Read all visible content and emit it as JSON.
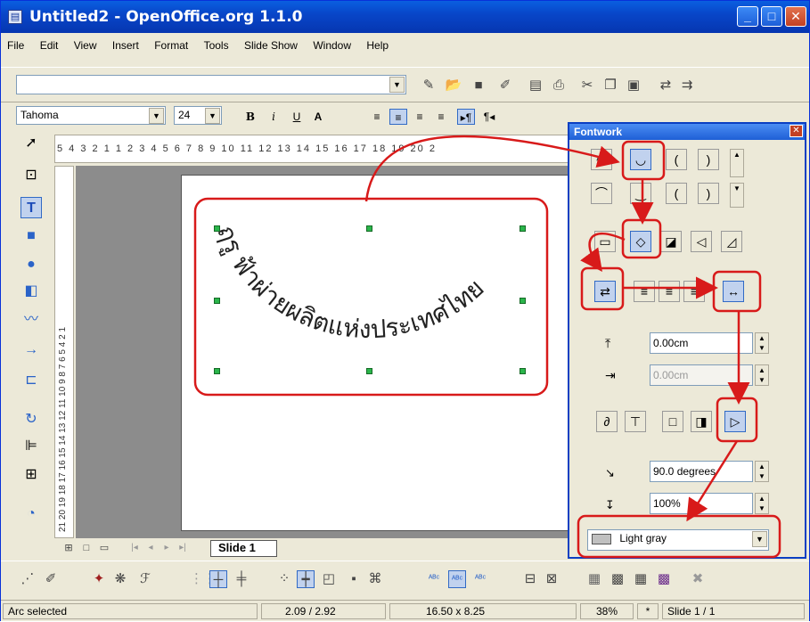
{
  "window": {
    "title": "Untitled2 - OpenOffice.org 1.1.0"
  },
  "menu": [
    "File",
    "Edit",
    "View",
    "Insert",
    "Format",
    "Tools",
    "Slide Show",
    "Window",
    "Help"
  ],
  "formatting": {
    "font_name": "Tahoma",
    "font_size": "24"
  },
  "ruler": {
    "horizontal": "5 4 3 2 1   1 2 3 4 5 6 7 8 9 10 11 12 13 14 15 16 17 18 19 20 2",
    "vertical": "21 20 19 18 17 16 15 14 13 12 11 10 9 8 7 6 5 4 2 1"
  },
  "slide": {
    "curved_text": "ฤรู ฟ้าผ่ายผลิตแห่งประเทศไทย",
    "tab_label": "Slide 1"
  },
  "fontwork": {
    "title": "Fontwork",
    "distance_value": "0.00cm",
    "indent_value": "0.00cm",
    "angle_value": "90.0 degrees",
    "width_value": "100%",
    "shadow_color": "Light gray"
  },
  "status": {
    "selection": "Arc selected",
    "position": "2.09 / 2.92",
    "size": "16.50 x 8.25",
    "zoom": "38%",
    "modified": "*",
    "page": "Slide 1 / 1"
  },
  "colors": {
    "annotation_red": "#d81a1a",
    "handle_green": "#2bb54b",
    "titlebar_blue": "#0846c9"
  }
}
